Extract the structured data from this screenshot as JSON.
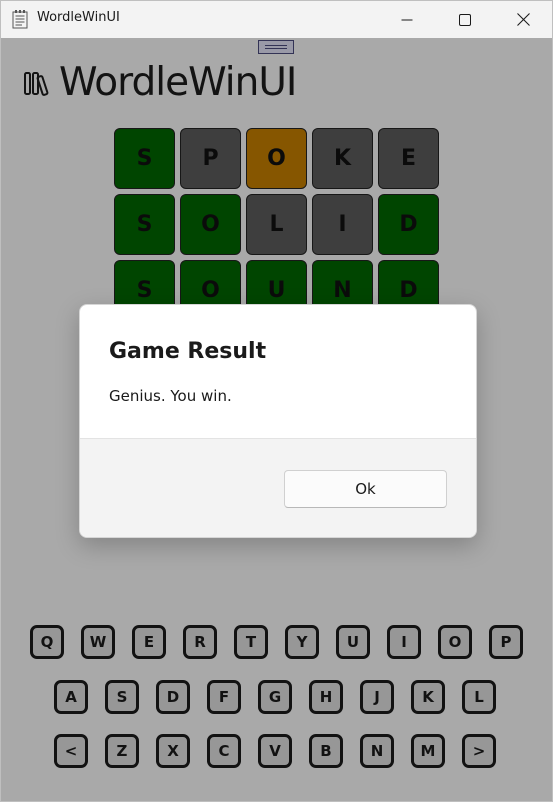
{
  "window": {
    "title": "WordleWinUI"
  },
  "app": {
    "heading": "WordleWinUI"
  },
  "colors": {
    "correct": "#006400",
    "present": "#c07b00",
    "absent": "#5a5a5a",
    "dim_overlay": "rgba(0,0,0,0.30)"
  },
  "grid": {
    "rows": [
      [
        {
          "letter": "S",
          "state": "correct"
        },
        {
          "letter": "P",
          "state": "absent"
        },
        {
          "letter": "O",
          "state": "present"
        },
        {
          "letter": "K",
          "state": "absent"
        },
        {
          "letter": "E",
          "state": "absent"
        }
      ],
      [
        {
          "letter": "S",
          "state": "correct"
        },
        {
          "letter": "O",
          "state": "correct"
        },
        {
          "letter": "L",
          "state": "absent"
        },
        {
          "letter": "I",
          "state": "absent"
        },
        {
          "letter": "D",
          "state": "correct"
        }
      ],
      [
        {
          "letter": "S",
          "state": "correct"
        },
        {
          "letter": "O",
          "state": "correct"
        },
        {
          "letter": "U",
          "state": "correct"
        },
        {
          "letter": "N",
          "state": "correct"
        },
        {
          "letter": "D",
          "state": "correct"
        }
      ]
    ]
  },
  "keyboard": {
    "rows": [
      [
        "Q",
        "W",
        "E",
        "R",
        "T",
        "Y",
        "U",
        "I",
        "O",
        "P"
      ],
      [
        "A",
        "S",
        "D",
        "F",
        "G",
        "H",
        "J",
        "K",
        "L"
      ],
      [
        "<",
        "Z",
        "X",
        "C",
        "V",
        "B",
        "N",
        "M",
        ">"
      ]
    ]
  },
  "dialog": {
    "title": "Game Result",
    "message": "Genius. You win.",
    "ok_label": "Ok"
  },
  "icons": {
    "app": "notepad-icon",
    "logo": "books-icon",
    "minimize": "minimize-icon",
    "maximize": "maximize-icon",
    "close": "close-icon"
  }
}
